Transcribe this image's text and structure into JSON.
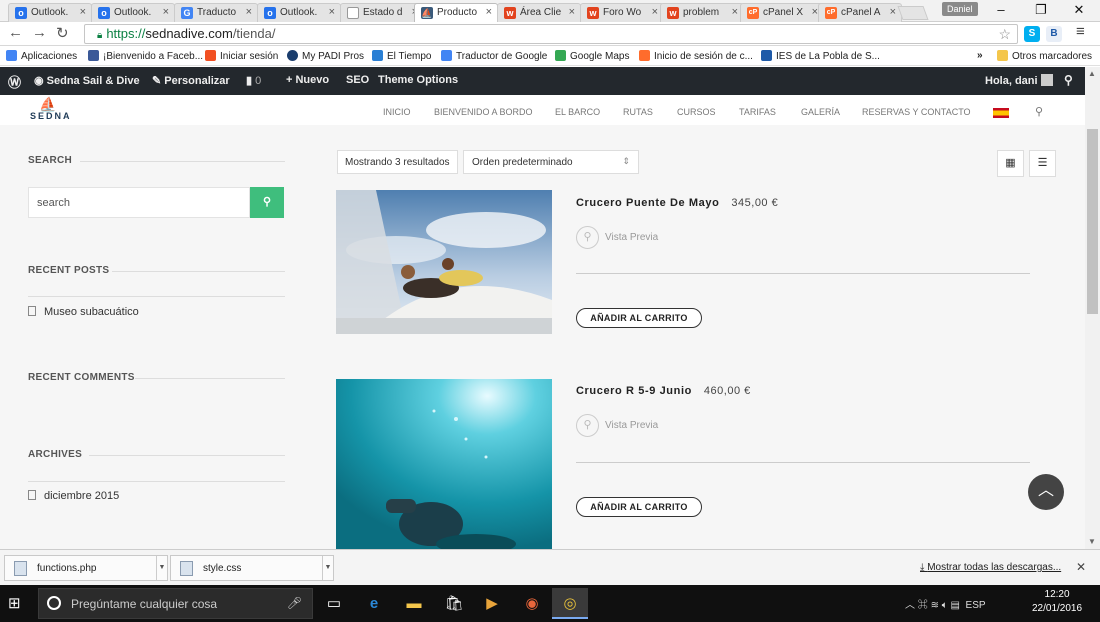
{
  "browser": {
    "tabs": [
      {
        "label": "Outlook.",
        "fav_color": "#2672ec",
        "fav_glyph": "o"
      },
      {
        "label": "Outlook.",
        "fav_color": "#2672ec",
        "fav_glyph": "o"
      },
      {
        "label": "Traducto",
        "fav_color": "#4285f4",
        "fav_glyph": "G"
      },
      {
        "label": "Outlook.",
        "fav_color": "#2672ec",
        "fav_glyph": "o"
      },
      {
        "label": "Estado d",
        "fav_color": "#9e9e9e",
        "fav_glyph": ""
      },
      {
        "label": "Producto",
        "fav_color": "#3a5a7a",
        "fav_glyph": "⛵"
      },
      {
        "label": "Área Clie",
        "fav_color": "#e2431e",
        "fav_glyph": "w"
      },
      {
        "label": "Foro Wo",
        "fav_color": "#e2431e",
        "fav_glyph": "w"
      },
      {
        "label": "problem",
        "fav_color": "#e2431e",
        "fav_glyph": "w"
      },
      {
        "label": "cPanel X",
        "fav_color": "#ff6c2c",
        "fav_glyph": "cP"
      },
      {
        "label": "cPanel A",
        "fav_color": "#ff6c2c",
        "fav_glyph": "cP"
      }
    ],
    "active_tab": 5,
    "profile_name": "Daniel",
    "url_secure": "https://",
    "url_domain": "sednadive.com",
    "url_path": "/tienda/",
    "bookmarks": [
      {
        "label": "Aplicaciones",
        "color": "#4285f4"
      },
      {
        "label": "¡Bienvenido a Faceb...",
        "color": "#3b5998"
      },
      {
        "label": "Iniciar sesión",
        "color": "#f25022"
      },
      {
        "label": "My PADI Pros",
        "color": "#1a3d6d"
      },
      {
        "label": "El Tiempo",
        "color": "#2a7fd4"
      },
      {
        "label": "Traductor de Google",
        "color": "#4285f4"
      },
      {
        "label": "Google Maps",
        "color": "#34a853"
      },
      {
        "label": "Inicio de sesión de c...",
        "color": "#ff6c2c"
      },
      {
        "label": "IES de La Pobla de S...",
        "color": "#1e5aa8"
      }
    ],
    "bookmarks_more": "»",
    "other_bookmarks": "Otros marcadores"
  },
  "wp_admin_bar": {
    "site_name": "Sedna Sail & Dive",
    "customize": "Personalizar",
    "comments_count": "0",
    "new_label": "Nuevo",
    "seo": "SEO",
    "theme_options": "Theme Options",
    "greeting": "Hola, dani"
  },
  "site": {
    "logo_text": "SEDNA",
    "menu": [
      "INICIO",
      "BIENVENIDO A BORDO",
      "EL BARCO",
      "RUTAS",
      "CURSOS",
      "TARIFAS",
      "GALERÍA",
      "RESERVAS Y CONTACTO"
    ]
  },
  "sidebar": {
    "search_title": "SEARCH",
    "search_placeholder": "search",
    "recent_posts_title": "RECENT POSTS",
    "recent_posts": [
      "Museo subacuático"
    ],
    "recent_comments_title": "RECENT COMMENTS",
    "archives_title": "ARCHIVES",
    "archives": [
      "diciembre 2015"
    ]
  },
  "shop": {
    "results_text": "Mostrando 3 resultados",
    "orderby_selected": "Orden predeterminado",
    "products": [
      {
        "name": "Crucero Puente De Mayo",
        "price": "345,00 €",
        "preview": "Vista Previa",
        "cart": "AÑADIR AL CARRITO"
      },
      {
        "name": "Crucero R 5-9 Junio",
        "price": "460,00 €",
        "preview": "Vista Previa",
        "cart": "AÑADIR AL CARRITO"
      }
    ]
  },
  "downloads": {
    "items": [
      "functions.php",
      "style.css"
    ],
    "show_all": "Mostrar todas las descargas..."
  },
  "taskbar": {
    "search_placeholder": "Pregúntame cualquier cosa",
    "language": "ESP",
    "time": "12:20",
    "date": "22/01/2016"
  },
  "colors": {
    "accent_green": "#3fbe7d",
    "wp_bar": "#23282d"
  }
}
